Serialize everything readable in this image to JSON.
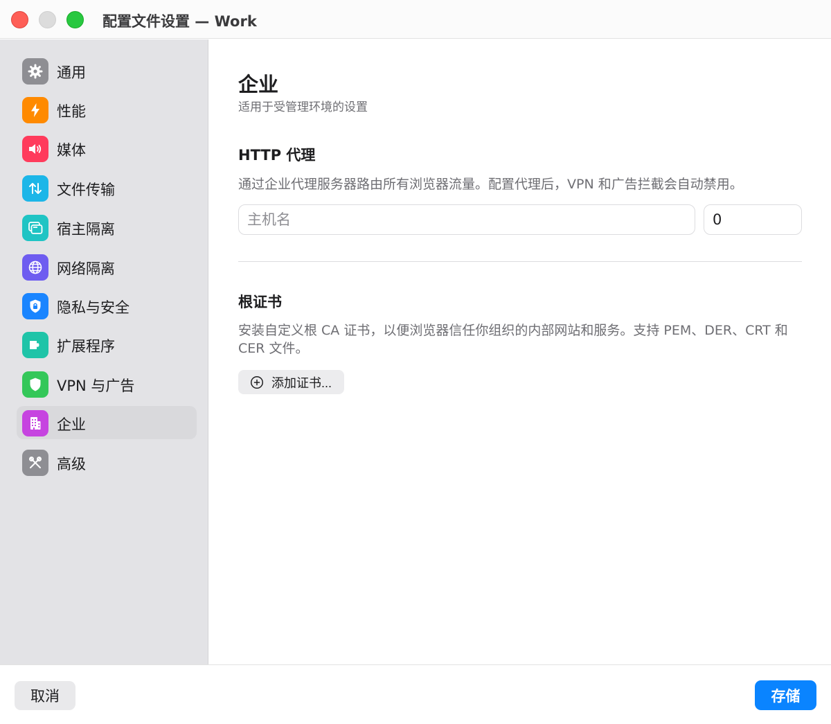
{
  "window": {
    "title": "配置文件设置 — Work"
  },
  "sidebar": {
    "items": [
      {
        "label": "通用",
        "icon": "gear-icon",
        "color": "#8e8e93"
      },
      {
        "label": "性能",
        "icon": "bolt-icon",
        "color": "#ff8a00"
      },
      {
        "label": "媒体",
        "icon": "speaker-icon",
        "color": "#ff3b5c"
      },
      {
        "label": "文件传输",
        "icon": "transfer-arrows-icon",
        "color": "#1cb6e8"
      },
      {
        "label": "宿主隔离",
        "icon": "window-stack-icon",
        "color": "#1fc4c4"
      },
      {
        "label": "网络隔离",
        "icon": "globe-icon",
        "color": "#6e5cf0"
      },
      {
        "label": "隐私与安全",
        "icon": "lock-shield-icon",
        "color": "#1a85ff"
      },
      {
        "label": "扩展程序",
        "icon": "puzzle-icon",
        "color": "#1fc4a8"
      },
      {
        "label": "VPN 与广告",
        "icon": "shield-icon",
        "color": "#34c759"
      },
      {
        "label": "企业",
        "icon": "building-icon",
        "color": "#c644e0",
        "active": true
      },
      {
        "label": "高级",
        "icon": "tools-icon",
        "color": "#8e8e93"
      }
    ]
  },
  "main": {
    "title": "企业",
    "subtitle": "适用于受管理环境的设置",
    "proxy": {
      "title": "HTTP 代理",
      "description": "通过企业代理服务器路由所有浏览器流量。配置代理后，VPN 和广告拦截会自动禁用。",
      "host_placeholder": "主机名",
      "host_value": "",
      "port_value": "0"
    },
    "certs": {
      "title": "根证书",
      "description": "安装自定义根 CA 证书，以便浏览器信任你组织的内部网站和服务。支持 PEM、DER、CRT 和 CER 文件。",
      "add_label": "添加证书..."
    }
  },
  "footer": {
    "cancel_label": "取消",
    "save_label": "存储"
  },
  "colors": {
    "accent": "#0a84ff"
  }
}
